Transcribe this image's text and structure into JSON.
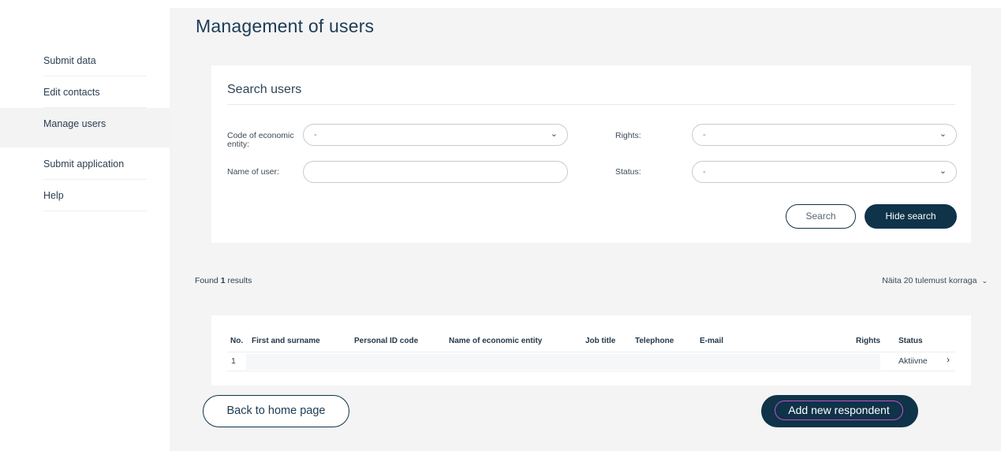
{
  "sidebar": {
    "items": [
      {
        "label": "Submit data"
      },
      {
        "label": "Edit contacts"
      },
      {
        "label": "Manage users",
        "active": true
      },
      {
        "label": "Submit application"
      },
      {
        "label": "Help"
      }
    ]
  },
  "page": {
    "title": "Management of users"
  },
  "search": {
    "title": "Search users",
    "code_label": "Code of economic entity:",
    "code_value": "-",
    "rights_label": "Rights:",
    "rights_value": "-",
    "name_label": "Name of user:",
    "name_value": "",
    "status_label": "Status:",
    "status_value": "-",
    "search_button": "Search",
    "hide_button": "Hide search"
  },
  "results": {
    "found_prefix": "Found",
    "found_count": "1",
    "found_suffix": "results",
    "per_page": "Näita 20 tulemust korraga"
  },
  "table": {
    "headers": {
      "no": "No.",
      "name": "First and surname",
      "id": "Personal ID code",
      "entity": "Name of economic entity",
      "job": "Job title",
      "phone": "Telephone",
      "email": "E-mail",
      "rights": "Rights",
      "status": "Status"
    },
    "rows": [
      {
        "no": "1",
        "status": "Aktiivne"
      }
    ]
  },
  "actions": {
    "back": "Back to home page",
    "add": "Add new respondent"
  },
  "icons": {
    "dropdown": "chevron-down-icon",
    "row_open": "chevron-right-icon"
  },
  "colors": {
    "primary": "#0f3349",
    "focus": "#c152c8"
  }
}
